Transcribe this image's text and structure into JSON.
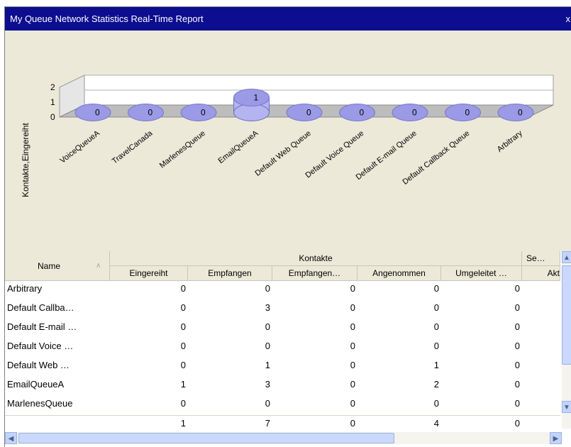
{
  "window": {
    "title": "My Queue Network Statistics Real-Time Report",
    "close_label": "x"
  },
  "chart_data": {
    "type": "bar",
    "categories": [
      "VoiceQueueA",
      "TravelCanada",
      "MarlenesQueue",
      "EmailQueueA",
      "Default Web Queue",
      "Default Voice Queue",
      "Default E-mail Queue",
      "Default Callback Queue",
      "Arbitrary"
    ],
    "values": [
      0,
      0,
      0,
      1,
      0,
      0,
      0,
      0,
      0
    ],
    "ylabel": "Kontakte,Eingereiht",
    "yticks": [
      "0",
      "1",
      "2"
    ],
    "ylim": [
      0,
      2
    ],
    "colors": {
      "top": "#9a9ae6",
      "side": "#b4b4f0",
      "floor": "#bdbdbd",
      "wall": "#ffffff"
    }
  },
  "grid": {
    "name_header": "Name",
    "sort_icon": "sort-asc-icon",
    "group_header": "Kontakte",
    "group2_header": "Se…",
    "columns": [
      "Eingereiht",
      "Empfangen",
      "Empfangen…",
      "Angenommen",
      "Umgeleitet …",
      "Akt"
    ],
    "rows": [
      {
        "name": "Arbitrary",
        "values": [
          "0",
          "0",
          "0",
          "0",
          "0"
        ]
      },
      {
        "name": "Default Callba…",
        "values": [
          "0",
          "3",
          "0",
          "0",
          "0"
        ]
      },
      {
        "name": "Default E-mail …",
        "values": [
          "0",
          "0",
          "0",
          "0",
          "0"
        ]
      },
      {
        "name": "Default Voice …",
        "values": [
          "0",
          "0",
          "0",
          "0",
          "0"
        ]
      },
      {
        "name": "Default Web …",
        "values": [
          "0",
          "1",
          "0",
          "1",
          "0"
        ]
      },
      {
        "name": "EmailQueueA",
        "values": [
          "1",
          "3",
          "0",
          "2",
          "0"
        ]
      },
      {
        "name": "MarlenesQueue",
        "values": [
          "0",
          "0",
          "0",
          "0",
          "0"
        ]
      }
    ],
    "totals": [
      "1",
      "7",
      "0",
      "4",
      "0"
    ]
  }
}
